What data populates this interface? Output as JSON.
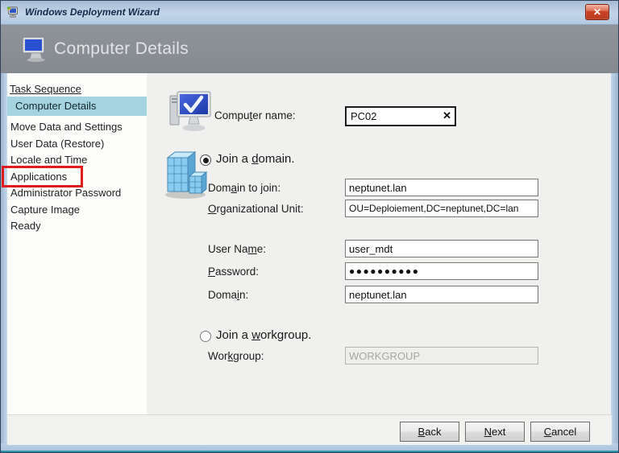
{
  "window": {
    "title": "Windows Deployment Wizard",
    "close_glyph": "✕"
  },
  "header": {
    "title": "Computer Details"
  },
  "sidebar": {
    "items": [
      {
        "label": "Task Sequence"
      },
      {
        "label": "Computer Details"
      },
      {
        "label": "Move Data and Settings"
      },
      {
        "label": "User Data (Restore)"
      },
      {
        "label": "Locale and Time"
      },
      {
        "label": "Applications"
      },
      {
        "label": "Administrator Password"
      },
      {
        "label": "Capture Image"
      },
      {
        "label": "Ready"
      }
    ],
    "selected_item": "Computer Details",
    "annotated_item": "Applications",
    "annotation_color": "#e01b1b",
    "selected_bg_color": "#a3d4e0"
  },
  "main": {
    "computer_name": {
      "label_pre": "Compu",
      "label_key": "t",
      "label_post": "er name:",
      "value": "PC02",
      "clear_glyph": "✕"
    },
    "domain_radio": {
      "pre": "Join a ",
      "key": "d",
      "post": "omain.",
      "selected": true
    },
    "domain_fields": [
      {
        "pre": "Dom",
        "key": "a",
        "post": "in to join:",
        "value": "neptunet.lan"
      },
      {
        "pre": "",
        "key": "O",
        "post": "rganizational Unit:",
        "value": "OU=Deploiement,DC=neptunet,DC=lan"
      },
      {
        "pre": "User Na",
        "key": "m",
        "post": "e:",
        "value": "user_mdt"
      },
      {
        "pre": "",
        "key": "P",
        "post": "assword:",
        "value": "●●●●●●●●●●"
      },
      {
        "pre": "Doma",
        "key": "i",
        "post": "n:",
        "value": "neptunet.lan"
      }
    ],
    "workgroup_radio": {
      "pre": "Join a ",
      "key": "w",
      "post": "orkgroup.",
      "selected": false
    },
    "workgroup_field": {
      "pre": "Wor",
      "key": "k",
      "post": "group:",
      "value": "WORKGROUP",
      "disabled": true
    }
  },
  "footer": {
    "back": {
      "pre": "",
      "key": "B",
      "post": "ack"
    },
    "next": {
      "pre": "",
      "key": "N",
      "post": "ext"
    },
    "cancel": {
      "pre": "",
      "key": "C",
      "post": "ancel"
    }
  }
}
